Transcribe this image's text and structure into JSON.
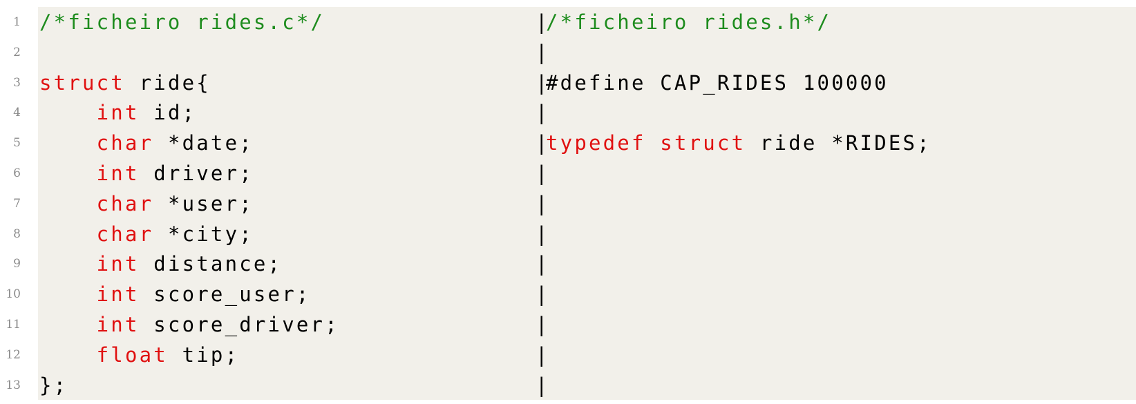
{
  "lines": [
    {
      "num": "1",
      "left": [
        {
          "t": "/*ficheiro rides.c*/",
          "c": "comment"
        }
      ],
      "right": [
        {
          "t": "/*ficheiro rides.h*/",
          "c": "comment"
        }
      ]
    },
    {
      "num": "2",
      "left": [],
      "right": []
    },
    {
      "num": "3",
      "left": [
        {
          "t": "struct",
          "c": "kw"
        },
        {
          "t": " ride{",
          "c": ""
        }
      ],
      "right": [
        {
          "t": "#define CAP_RIDES 100000",
          "c": ""
        }
      ]
    },
    {
      "num": "4",
      "left": [
        {
          "t": "    ",
          "c": ""
        },
        {
          "t": "int",
          "c": "kw"
        },
        {
          "t": " id;",
          "c": ""
        }
      ],
      "right": []
    },
    {
      "num": "5",
      "left": [
        {
          "t": "    ",
          "c": ""
        },
        {
          "t": "char",
          "c": "kw"
        },
        {
          "t": " *date;",
          "c": ""
        }
      ],
      "right": [
        {
          "t": "typedef",
          "c": "kw"
        },
        {
          "t": " ",
          "c": ""
        },
        {
          "t": "struct",
          "c": "kw"
        },
        {
          "t": " ride *RIDES;",
          "c": ""
        }
      ]
    },
    {
      "num": "6",
      "left": [
        {
          "t": "    ",
          "c": ""
        },
        {
          "t": "int",
          "c": "kw"
        },
        {
          "t": " driver;",
          "c": ""
        }
      ],
      "right": []
    },
    {
      "num": "7",
      "left": [
        {
          "t": "    ",
          "c": ""
        },
        {
          "t": "char",
          "c": "kw"
        },
        {
          "t": " *user;",
          "c": ""
        }
      ],
      "right": []
    },
    {
      "num": "8",
      "left": [
        {
          "t": "    ",
          "c": ""
        },
        {
          "t": "char",
          "c": "kw"
        },
        {
          "t": " *city;",
          "c": ""
        }
      ],
      "right": []
    },
    {
      "num": "9",
      "left": [
        {
          "t": "    ",
          "c": ""
        },
        {
          "t": "int",
          "c": "kw"
        },
        {
          "t": " distance;",
          "c": ""
        }
      ],
      "right": []
    },
    {
      "num": "10",
      "left": [
        {
          "t": "    ",
          "c": ""
        },
        {
          "t": "int",
          "c": "kw"
        },
        {
          "t": " score_user;",
          "c": ""
        }
      ],
      "right": []
    },
    {
      "num": "11",
      "left": [
        {
          "t": "    ",
          "c": ""
        },
        {
          "t": "int",
          "c": "kw"
        },
        {
          "t": " score_driver;",
          "c": ""
        }
      ],
      "right": []
    },
    {
      "num": "12",
      "left": [
        {
          "t": "    ",
          "c": ""
        },
        {
          "t": "float",
          "c": "kw"
        },
        {
          "t": " tip;",
          "c": ""
        }
      ],
      "right": []
    },
    {
      "num": "13",
      "left": [
        {
          "t": "};",
          "c": ""
        }
      ],
      "right": []
    }
  ],
  "separator": "|",
  "colors": {
    "keyword": "#e01010",
    "comment": "#1e8c1e",
    "background": "#f2f0ea",
    "line_number": "#8a8a8a"
  }
}
